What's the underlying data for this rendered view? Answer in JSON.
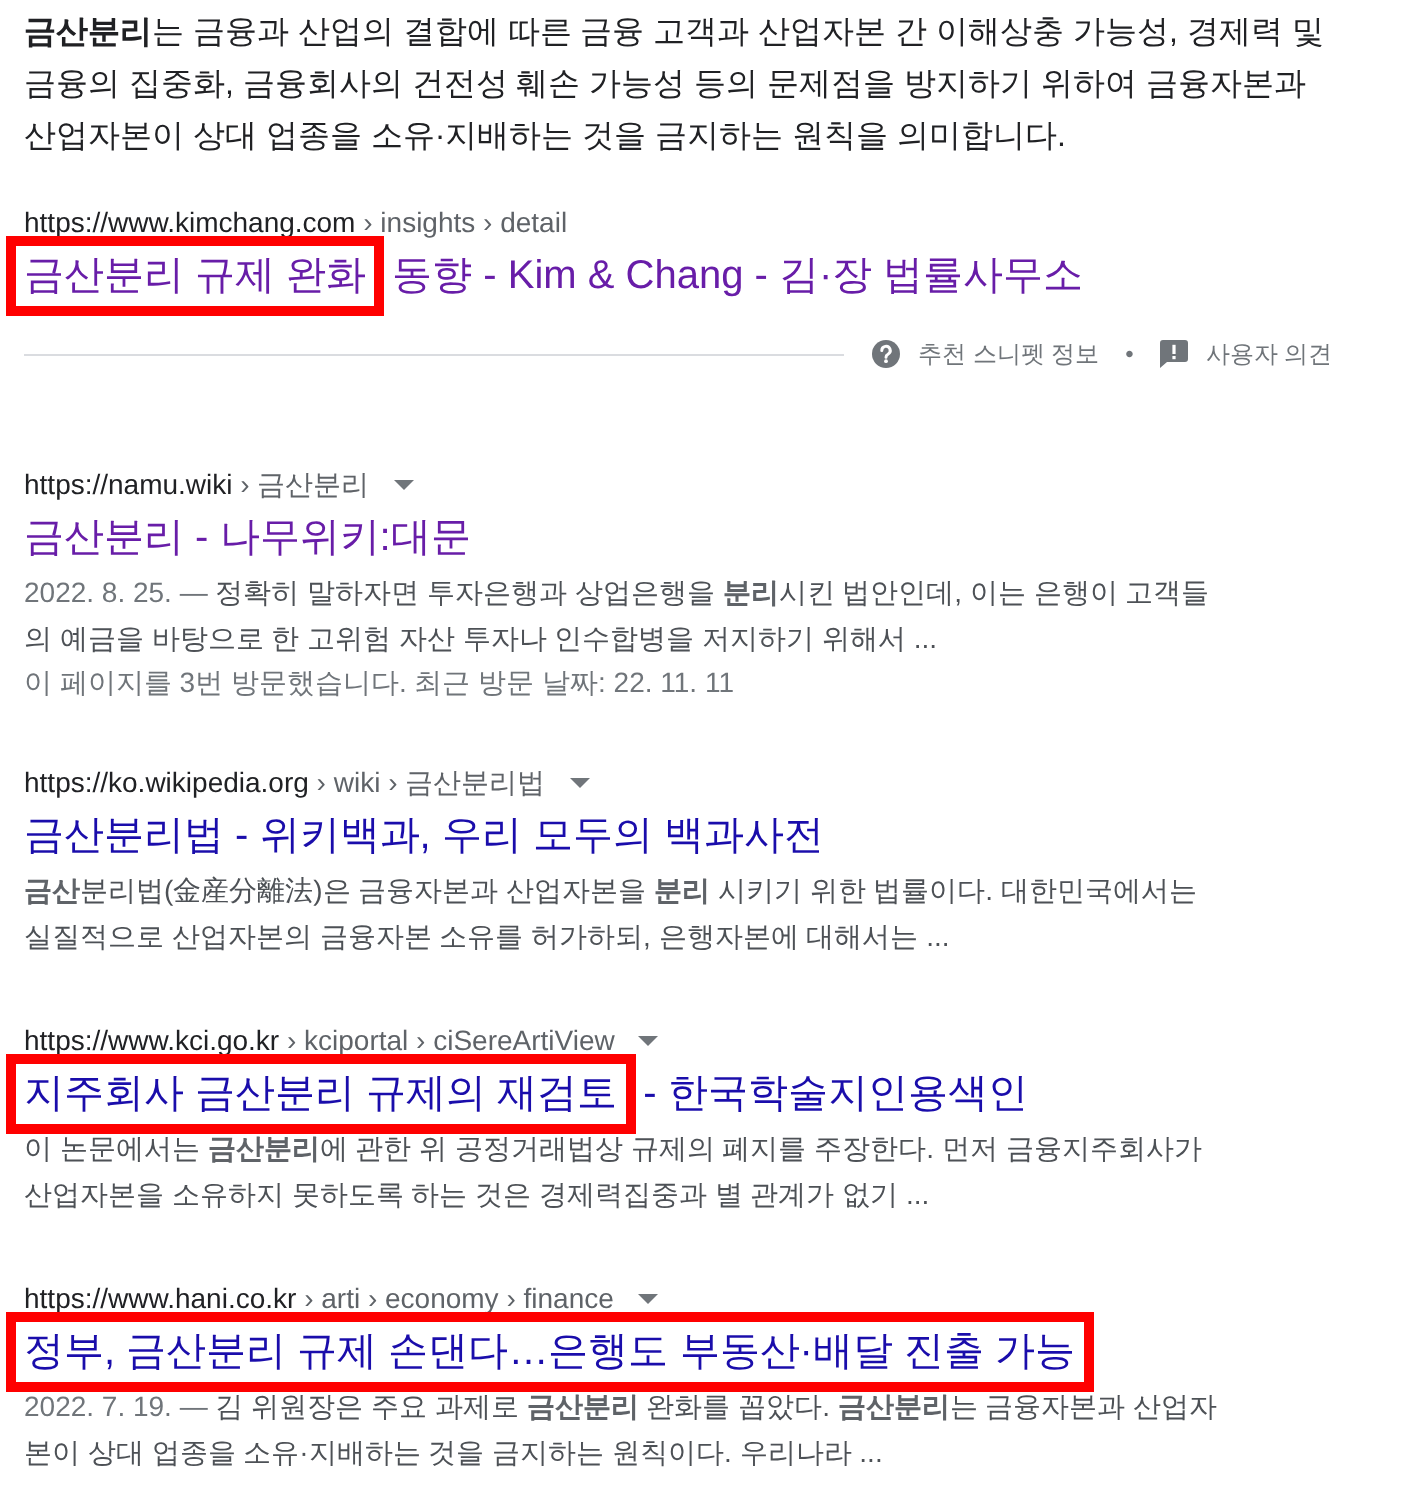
{
  "featured_snippet": {
    "text": "**금산분리**는 금융과 산업의 결합에 따른 금융 고객과 산업자본 간 이해상충 가능성, 경제력 및 금융의 집중화, 금융회사의 건전성 훼손 가능성 등의 문제점을 방지하기 위하여 금융자본과 산업자본이 상대 업종을 소유·지배하는 것을 금지하는 원칙을 의미합니다.",
    "url": "https://www.kimchang.com",
    "path": "› insights › detail",
    "visited": true,
    "title_parts": [
      {
        "text": "금산분리 규제 완화",
        "highlighted": true
      },
      {
        "text": "동향 - Kim & Chang - 김·장 법률사무소",
        "highlighted": false
      }
    ]
  },
  "snippet_footer": {
    "about_label": "추천 스니펫 정보",
    "separator": "•",
    "feedback_label": "사용자 의견"
  },
  "results": [
    {
      "url": "https://namu.wiki",
      "path": "› 금산분리",
      "menu_caret": true,
      "visited": true,
      "title_parts": [
        {
          "text": "금산분리 - 나무위키:대문",
          "highlighted": false
        }
      ],
      "date": "2022. 8. 25. —",
      "snippet": "정확히 말하자면 투자은행과 상업은행을 **분리**시킨 법안인데, 이는 은행이 고객들의 예금을 바탕으로 한 고위험 자산 투자나 인수합병을 저지하기 위해서 ...",
      "visit_note": "이 페이지를 3번 방문했습니다. 최근 방문 날짜: 22. 11. 11"
    },
    {
      "url": "https://ko.wikipedia.org",
      "path": "› wiki › 금산분리법",
      "menu_caret": true,
      "visited": false,
      "title_parts": [
        {
          "text": "금산분리법 - 위키백과, 우리 모두의 백과사전",
          "highlighted": false
        }
      ],
      "snippet": "**금산**분리법(金産分離法)은 금융자본과 산업자본을 **분리** 시키기 위한 법률이다. 대한민국에서는 실질적으로 산업자본의 금융자본 소유를 허가하되, 은행자본에 대해서는 ..."
    },
    {
      "url": "https://www.kci.go.kr",
      "path": "› kciportal › ciSereArtiView",
      "menu_caret": true,
      "visited": false,
      "title_parts": [
        {
          "text": "지주회사 금산분리 규제의 재검토",
          "highlighted": true
        },
        {
          "text": "- 한국학술지인용색인",
          "highlighted": false
        }
      ],
      "snippet": "이 논문에서는 **금산분리**에 관한 위 공정거래법상 규제의 폐지를 주장한다. 먼저 금융지주회사가 산업자본을 소유하지 못하도록 하는 것은 경제력집중과 별 관계가 없기 ..."
    },
    {
      "url": "https://www.hani.co.kr",
      "path": "› arti › economy › finance",
      "menu_caret": true,
      "visited": false,
      "title_parts": [
        {
          "text": "정부, 금산분리 규제 손댄다…은행도 부동산·배달 진출 가능",
          "highlighted": true
        }
      ],
      "date": "2022. 7. 19. —",
      "snippet": "김 위원장은 주요 과제로 **금산분리** 완화를 꼽았다. **금산분리**는 금융자본과 산업자본이 상대 업종을 소유·지배하는 것을 금지하는 원칙이다. 우리나라 ..."
    }
  ]
}
